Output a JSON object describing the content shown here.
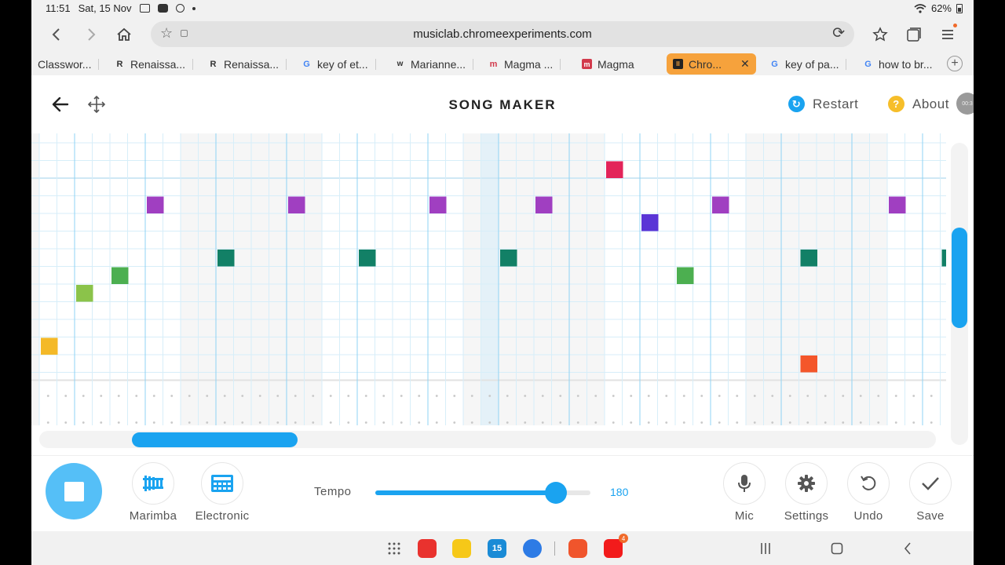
{
  "status_bar": {
    "time": "11:51",
    "date": "Sat, 15 Nov",
    "battery": "62%"
  },
  "browser": {
    "url": "musiclab.chromeexperiments.com",
    "tabs": [
      {
        "label": "Classwor...",
        "favicon": "",
        "favicon_color": "#4caf50"
      },
      {
        "label": "Renaissa...",
        "favicon": "R",
        "favicon_color": "#111111"
      },
      {
        "label": "Renaissa...",
        "favicon": "R",
        "favicon_color": "#111111"
      },
      {
        "label": "key of et...",
        "favicon": "G",
        "favicon_color": "#4285f4"
      },
      {
        "label": "Marianne...",
        "favicon": "w",
        "favicon_color": "#444444"
      },
      {
        "label": "Magma ...",
        "favicon": "m",
        "favicon_color": "#d23a4c"
      },
      {
        "label": "Magma",
        "favicon": "m",
        "favicon_color": "#d23a4c"
      },
      {
        "label": "Chro...",
        "favicon": "II",
        "favicon_color": "#222222",
        "active": true
      },
      {
        "label": "key of pa...",
        "favicon": "G",
        "favicon_color": "#4285f4"
      },
      {
        "label": "how to br...",
        "favicon": "G",
        "favicon_color": "#4285f4"
      }
    ],
    "new_tab": "+"
  },
  "app": {
    "title": "SONG MAKER",
    "restart_label": "Restart",
    "about_label": "About",
    "about_glyph": "?",
    "recording_badge": "00:3"
  },
  "grid": {
    "columns": 52,
    "melody_rows": 13,
    "rhythm_rows": 2,
    "highlight_column": 26,
    "notes": [
      {
        "col": 0,
        "row": 11,
        "color": "#f4b928"
      },
      {
        "col": 2,
        "row": 8,
        "color": "#8bc34a"
      },
      {
        "col": 4,
        "row": 7,
        "color": "#4caf50"
      },
      {
        "col": 6,
        "row": 3,
        "color": "#a03fc1"
      },
      {
        "col": 10,
        "row": 6,
        "color": "#128066"
      },
      {
        "col": 14,
        "row": 3,
        "color": "#a03fc1"
      },
      {
        "col": 18,
        "row": 6,
        "color": "#128066"
      },
      {
        "col": 22,
        "row": 3,
        "color": "#a03fc1"
      },
      {
        "col": 26,
        "row": 6,
        "color": "#128066"
      },
      {
        "col": 28,
        "row": 3,
        "color": "#a03fc1"
      },
      {
        "col": 32,
        "row": 1,
        "color": "#e3245a"
      },
      {
        "col": 34,
        "row": 4,
        "color": "#5a35d6"
      },
      {
        "col": 36,
        "row": 7,
        "color": "#4caf50"
      },
      {
        "col": 38,
        "row": 3,
        "color": "#a03fc1"
      },
      {
        "col": 43,
        "row": 6,
        "color": "#128066"
      },
      {
        "col": 43,
        "row": 12,
        "color": "#f4562a"
      },
      {
        "col": 48,
        "row": 3,
        "color": "#a03fc1"
      },
      {
        "col": 51,
        "row": 6,
        "color": "#128066"
      }
    ],
    "horizontal_scroll_fraction": 0.1,
    "vertical_scroll_fraction": 0.35
  },
  "controls": {
    "instrument_1": "Marimba",
    "instrument_2": "Electronic",
    "tempo_label": "Tempo",
    "tempo_value": "180",
    "tempo_fraction": 0.84,
    "mic_label": "Mic",
    "settings_label": "Settings",
    "undo_label": "Undo",
    "save_label": "Save"
  },
  "colors": {
    "accent": "#1aa3f0",
    "play_button": "#55bff7",
    "grid_line": "#d7eef9",
    "bar_line": "#8fd3f4",
    "restart_icon": "#1aa3f0",
    "about_icon": "#f6be2a"
  },
  "nav": {
    "youtube_badge": "4",
    "calendar_day": "15"
  }
}
